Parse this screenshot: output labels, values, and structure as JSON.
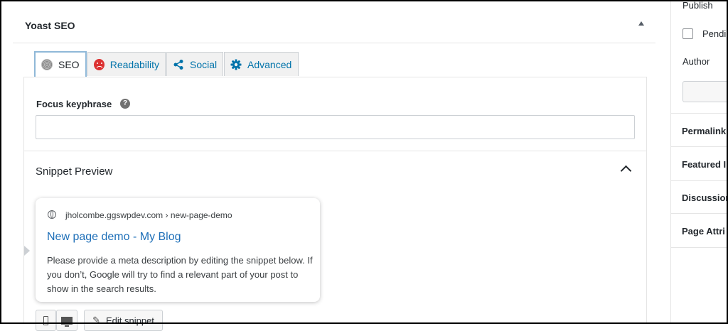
{
  "metabox": {
    "title": "Yoast SEO",
    "tabs": [
      {
        "label": "SEO",
        "icon": "seo-score-icon"
      },
      {
        "label": "Readability",
        "icon": "sad-face-icon"
      },
      {
        "label": "Social",
        "icon": "share-icon"
      },
      {
        "label": "Advanced",
        "icon": "gear-icon"
      }
    ],
    "focus_keyphrase": {
      "label": "Focus keyphrase",
      "help": "?",
      "value": ""
    },
    "snippet": {
      "title": "Snippet Preview",
      "url": "jholcombe.ggswpdev.com › new-page-demo",
      "page_title": "New page demo - My Blog",
      "description": "Please provide a meta description by editing the snippet below. If you don’t, Google will try to find a relevant part of your post to show in the search results.",
      "edit_label": "Edit snippet"
    }
  },
  "sidebar": {
    "publish": "Publish",
    "pending": "Pendi",
    "author": "Author",
    "sections": [
      "Permalink",
      "Featured I",
      "Discussion",
      "Page Attri"
    ]
  },
  "colors": {
    "link": "#0073aa",
    "title_link": "#1e6fb8",
    "sad": "#dc3232",
    "share": "#0073aa"
  }
}
